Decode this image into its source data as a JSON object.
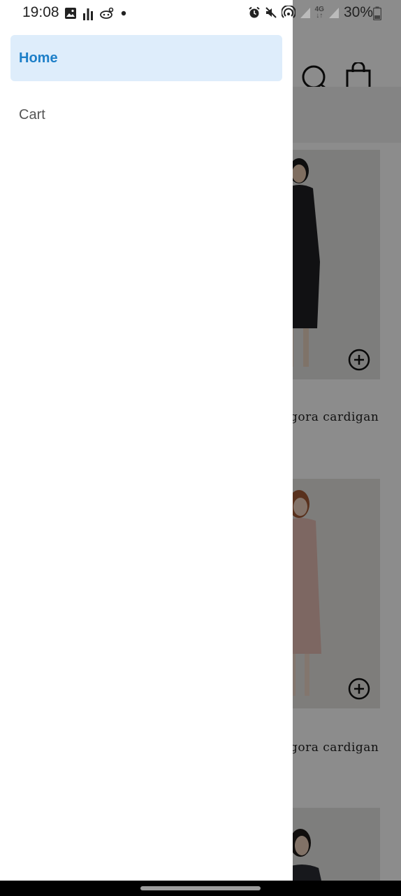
{
  "status_bar": {
    "time": "19:08",
    "network": "4G",
    "battery": "30%"
  },
  "drawer": {
    "items": [
      {
        "label": "Home",
        "active": true
      },
      {
        "label": "Cart",
        "active": false
      }
    ]
  },
  "products": [
    {
      "title_visible": "gora cardigan"
    },
    {
      "title_visible": "gora cardigan"
    }
  ],
  "colors": {
    "accent": "#1d7fc8",
    "active_bg": "#deedfb",
    "filter_icon": "#e07a3a"
  },
  "icons": [
    "search-icon",
    "bag-icon",
    "list-view-icon",
    "filter-icon",
    "add-circle-icon"
  ]
}
